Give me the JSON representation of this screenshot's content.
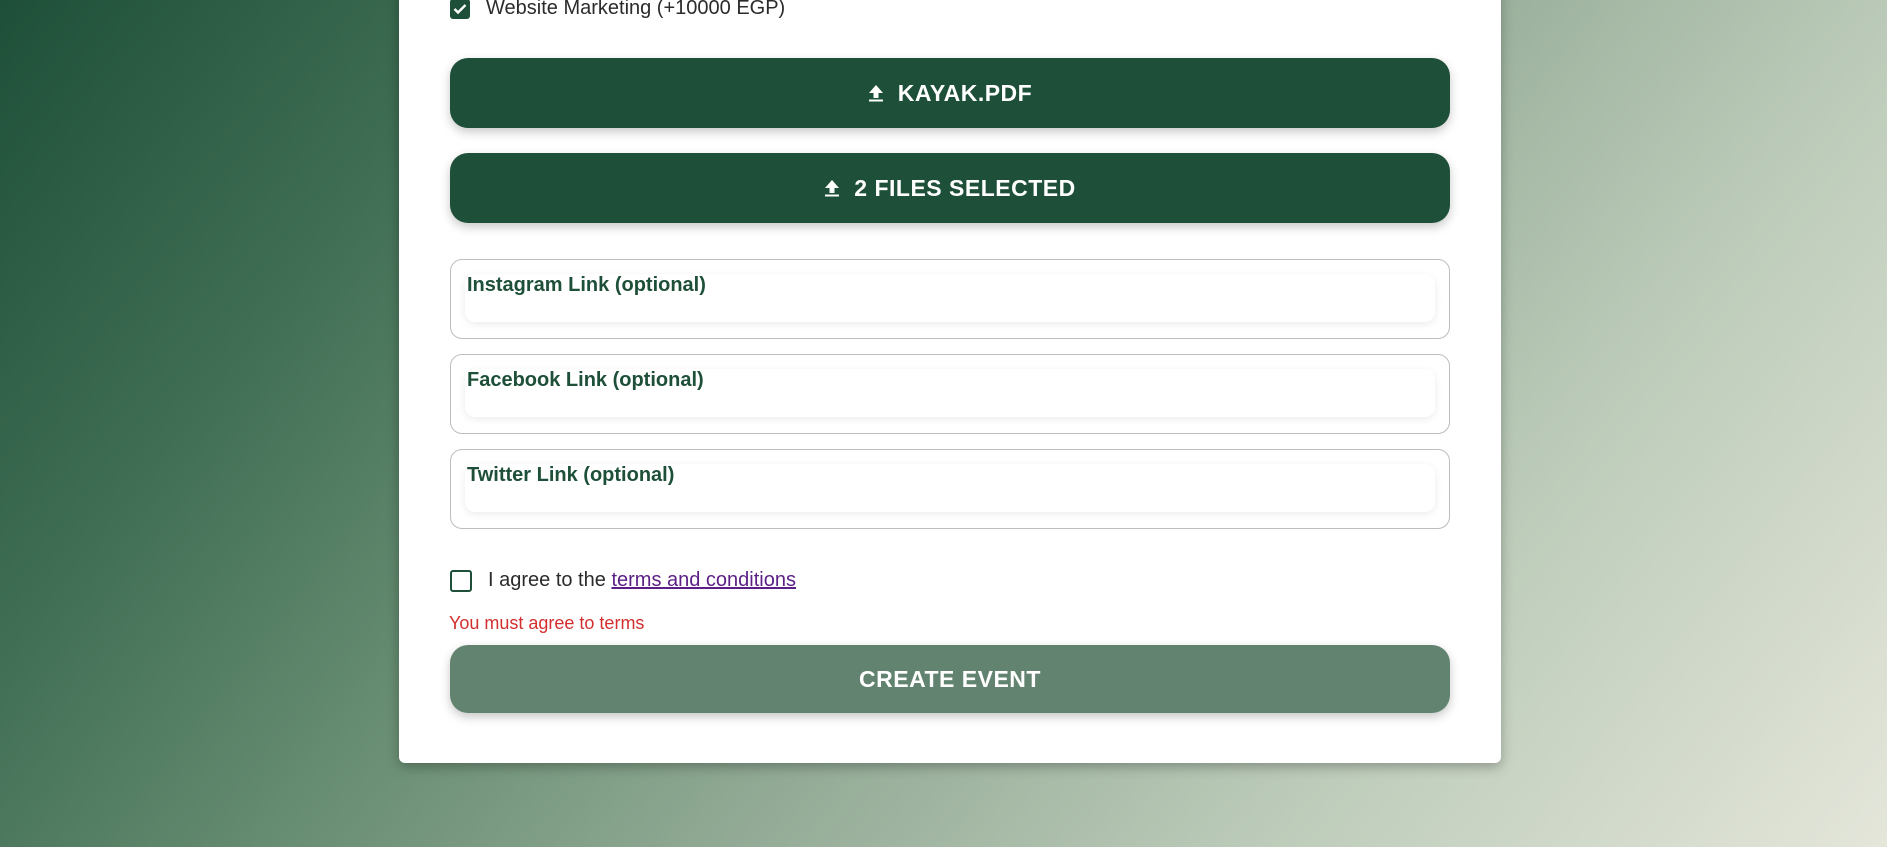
{
  "form": {
    "marketing_option": {
      "label": "Website Marketing (+10000 EGP)",
      "checked": true
    },
    "upload_buttons": [
      {
        "label": "KAYAK.PDF",
        "icon": "upload-icon"
      },
      {
        "label": "2 FILES SELECTED",
        "icon": "upload-icon"
      }
    ],
    "fields": [
      {
        "label": "Instagram Link (optional)",
        "value": ""
      },
      {
        "label": "Facebook Link (optional)",
        "value": ""
      },
      {
        "label": "Twitter Link (optional)",
        "value": ""
      }
    ],
    "terms": {
      "prefix": "I agree to the",
      "link_text": "terms and conditions",
      "checked": false,
      "error": "You must agree to terms"
    },
    "submit_label": "CREATE EVENT"
  },
  "colors": {
    "primary": "#1e4f38",
    "submit_disabled": "#628370",
    "error": "#d32f2f",
    "link": "#5b1f86"
  }
}
